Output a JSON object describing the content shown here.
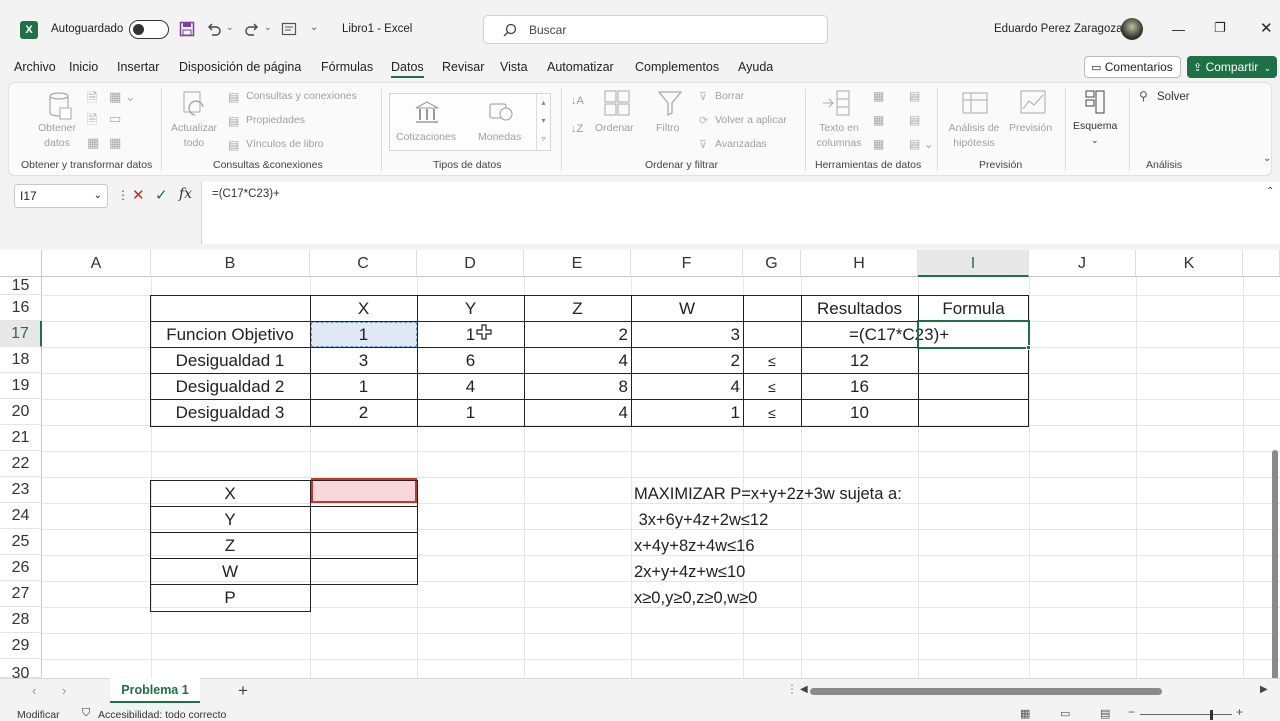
{
  "titlebar": {
    "autosave_label": "Autoguardado",
    "doc_title": "Libro1  -  Excel",
    "search_placeholder": "Buscar",
    "user_name": "Eduardo Perez Zaragoza"
  },
  "menu": [
    "Archivo",
    "Inicio",
    "Insertar",
    "Disposición de página",
    "Fórmulas",
    "Datos",
    "Revisar",
    "Vista",
    "Automatizar",
    "Complementos",
    "Ayuda"
  ],
  "menu_active": "Datos",
  "buttons": {
    "comments": "Comentarios",
    "share": "Compartir"
  },
  "ribbon": {
    "get_data": "Obtener datos",
    "refresh_all": "Actualizar todo",
    "queries_connections": "Consultas y conexiones",
    "properties": "Propiedades",
    "book_links": "Vínculos de libro",
    "stocks": "Cotizaciones",
    "currencies": "Monedas",
    "sort": "Ordenar",
    "filter": "Filtro",
    "clear": "Borrar",
    "reapply": "Volver a aplicar",
    "advanced": "Avanzadas",
    "text_to_columns": "Texto en columnas",
    "what_if": "Análisis de hipótesis",
    "forecast": "Previsión",
    "outline": "Esquema",
    "solver": "Solver",
    "groups": [
      "Obtener y transformar datos",
      "Consultas &conexiones",
      "Tipos de datos",
      "Ordenar y filtrar",
      "Herramientas de datos",
      "Previsión",
      "Análisis"
    ]
  },
  "formula_bar": {
    "name_box": "I17",
    "formula": "=(C17*C23)+"
  },
  "columns": [
    "A",
    "B",
    "C",
    "D",
    "E",
    "F",
    "G",
    "H",
    "I",
    "J",
    "K"
  ],
  "selected_column": "I",
  "rows": [
    "15",
    "16",
    "17",
    "18",
    "19",
    "20",
    "21",
    "22",
    "23",
    "24",
    "25",
    "26",
    "27",
    "28",
    "29",
    "30"
  ],
  "selected_row": "17",
  "table": {
    "headers": {
      "C": "X",
      "D": "Y",
      "E": "Z",
      "F": "W",
      "H": "Resultados",
      "I": "Formula"
    },
    "rows": [
      {
        "label": "Funcion Objetivo",
        "C": "1",
        "D": "1",
        "E": "2",
        "F": "3",
        "G": "",
        "H": "=(C17*C23)+",
        "I": ""
      },
      {
        "label": "Desigualdad 1",
        "C": "3",
        "D": "6",
        "E": "4",
        "F": "2",
        "G": "≤",
        "H": "12",
        "I": ""
      },
      {
        "label": "Desigualdad 2",
        "C": "1",
        "D": "4",
        "E": "8",
        "F": "4",
        "G": "≤",
        "H": "16",
        "I": ""
      },
      {
        "label": "Desigualdad 3",
        "C": "2",
        "D": "1",
        "E": "4",
        "F": "1",
        "G": "≤",
        "H": "10",
        "I": ""
      }
    ]
  },
  "variables": [
    "X",
    "Y",
    "Z",
    "W",
    "P"
  ],
  "problem_text": [
    "MAXIMIZAR P=x+y+2z+3w sujeta a:",
    " 3x+6y+4z+2w≤12",
    "x+4y+8z+4w≤16",
    "2x+y+4z+w≤10",
    "x≥0,y≥0,z≥0,w≥0"
  ],
  "sheet_tab": "Problema 1",
  "status": {
    "mode": "Modificar",
    "accessibility": "Accesibilidad: todo correcto"
  },
  "colors": {
    "accent": "#1e7145",
    "share_bg": "#1e7145",
    "selected_fill": "#dfe9f5",
    "pink_fill": "#f8d7da"
  }
}
